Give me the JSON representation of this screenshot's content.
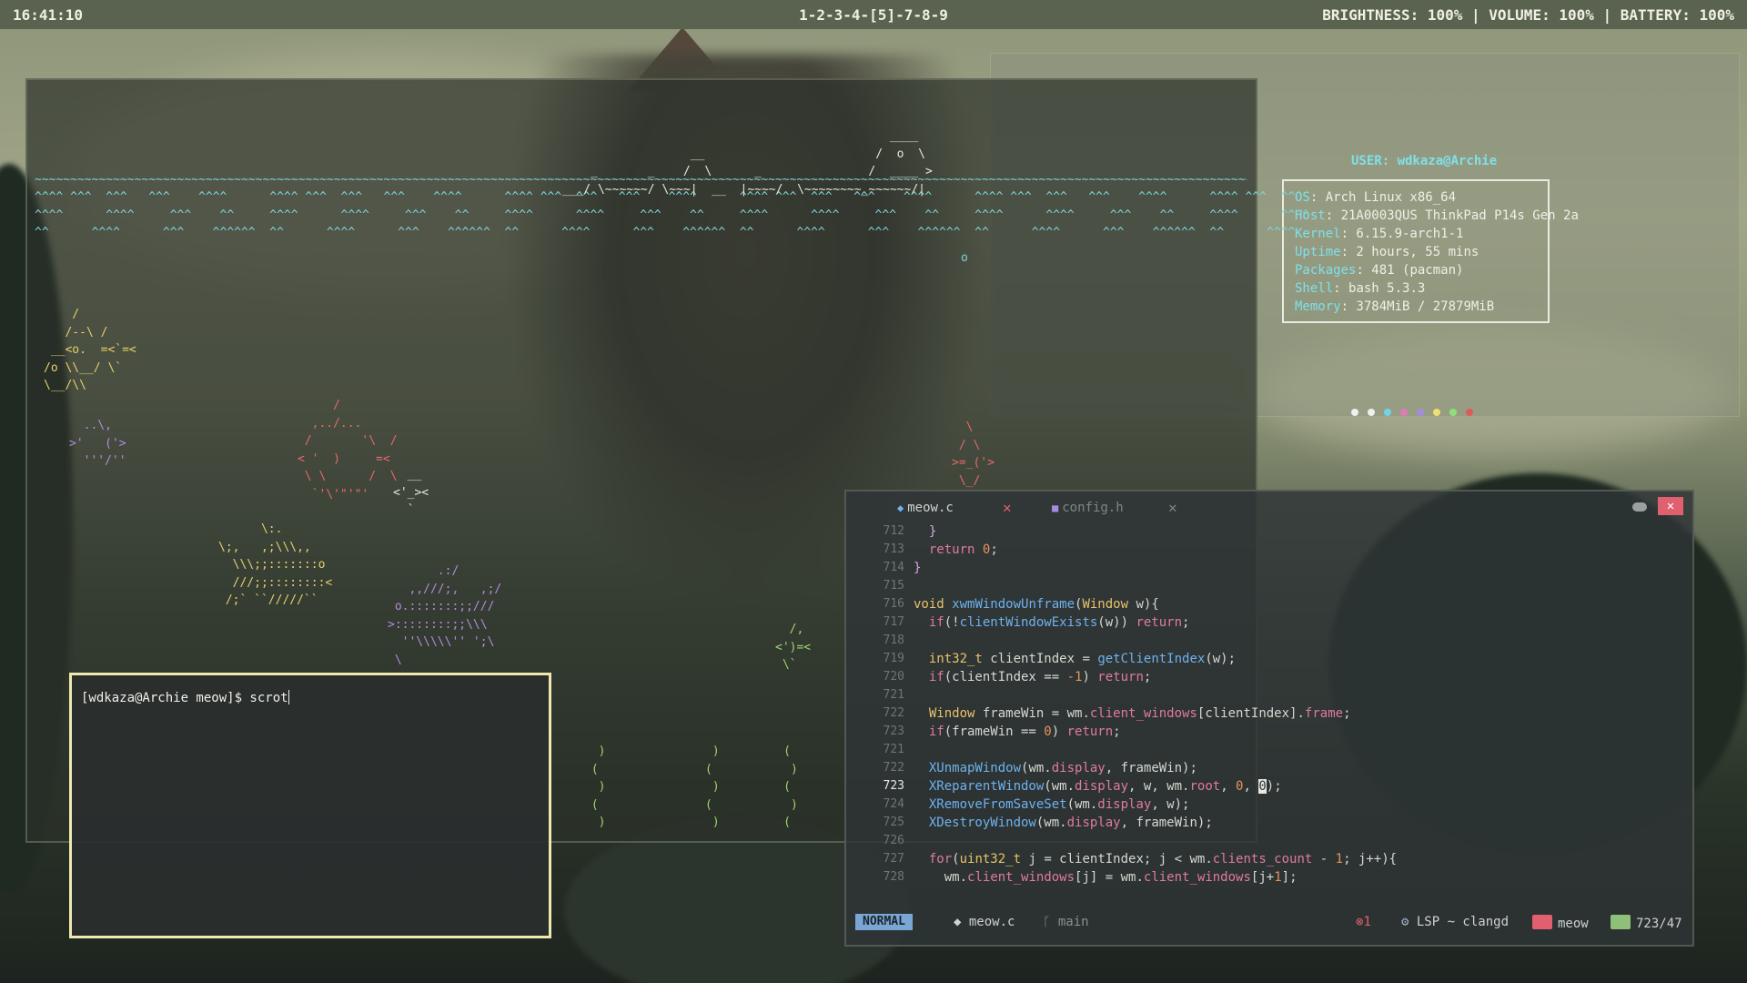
{
  "topbar": {
    "clock": "16:41:10",
    "workspaces": "1-2-3-4-[5]-7-8-9",
    "status": "BRIGHTNESS: 100% | VOLUME: 100% | BATTERY: 100%"
  },
  "fetch": {
    "user_label": "USER: wdkaza@Archie",
    "rows": [
      {
        "key": "OS",
        "value": ": Arch Linux x86_64"
      },
      {
        "key": "Host",
        "value": ": 21A0003QUS ThinkPad P14s Gen 2a"
      },
      {
        "key": "Kernel",
        "value": ": 6.15.9-arch1-1"
      },
      {
        "key": "Uptime",
        "value": ": 2 hours, 55 mins"
      },
      {
        "key": "Packages",
        "value": ": 481 (pacman)"
      },
      {
        "key": "Shell",
        "value": ": bash 5.3.3"
      },
      {
        "key": "Memory",
        "value": ": 3784MiB / 27879MiB"
      }
    ],
    "dot_colors": [
      "#f0f0f0",
      "#f0f0f0",
      "#6fd6e8",
      "#e07ab8",
      "#a58be0",
      "#f0e070",
      "#8fe07a",
      "#e05a5a"
    ]
  },
  "terminal": {
    "prompt": "[wdkaza@Archie meow]$ scrot"
  },
  "editor": {
    "tabs": [
      {
        "label": "meow.c",
        "icon": "c-file-icon",
        "active": true
      },
      {
        "label": "config.h",
        "icon": "header-file-icon",
        "active": false
      }
    ],
    "close_glyph": "✕",
    "status": {
      "mode": "NORMAL",
      "file": "meow.c",
      "branch": "main",
      "errors": "1",
      "lsp": "LSP ~ clangd",
      "project": "meow",
      "position": "723/47"
    },
    "colors": {
      "mode": "#7aa6d6",
      "project": "#e06070",
      "position": "#8fc07a"
    }
  },
  "ascii": {
    "top_wave": "~~~~~~~~~~~~~~~~~~~~~~~~~~~~~~~~~~~~~~~~~~~~~~~~~~~~~~~~~~~~~~~~~~~~~~~~~~~~~~~~~~~~~~~~~~~~~~~~~~~~~~~~~~~~~~~~~~~~~~~~~~~~~~~~~~~~~~~~~~~~~~~~~~~~~~~~~~~~~~~~~~~~~~~~~~~~"
  }
}
